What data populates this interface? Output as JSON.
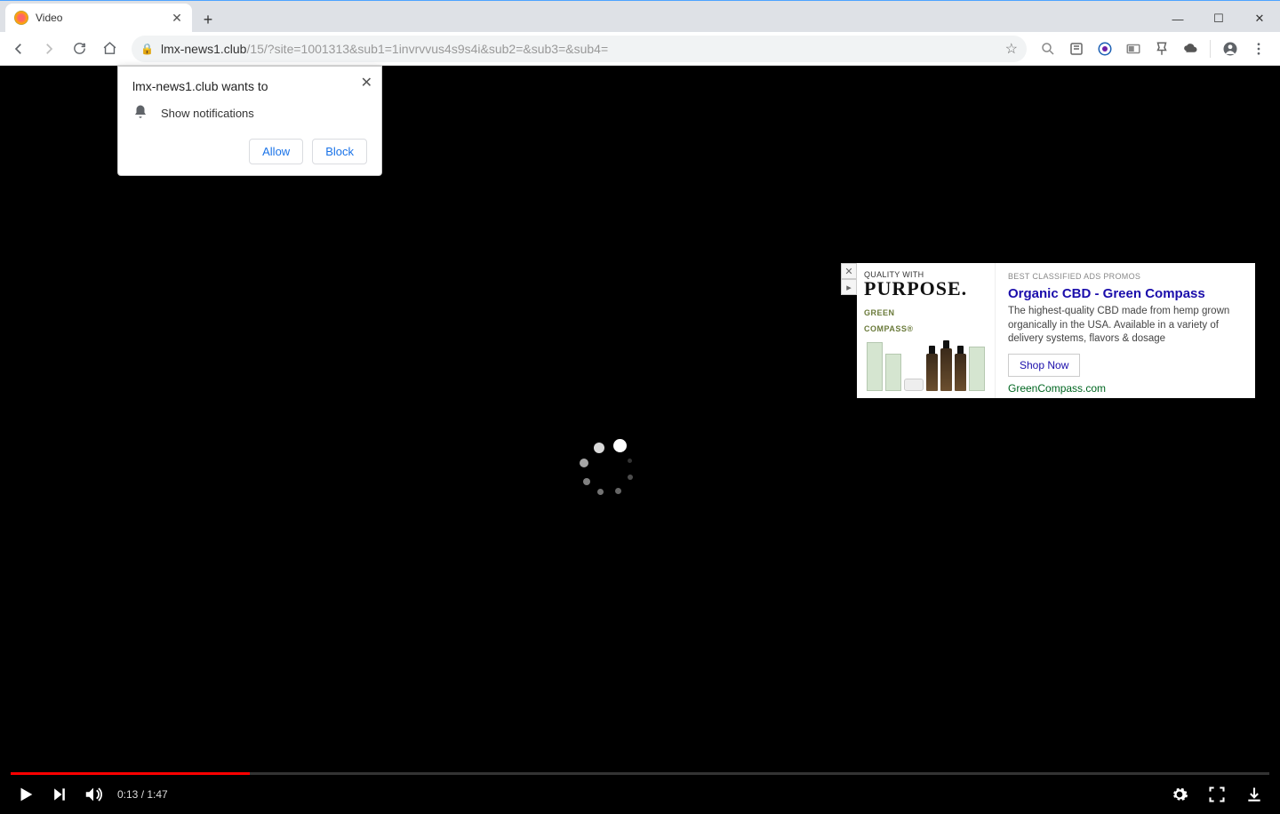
{
  "tab": {
    "title": "Video"
  },
  "url": {
    "domain": "lmx-news1.club",
    "path": "/15/?site=1001313&sub1=1invrvvus4s9s4i&sub2=&sub3=&sub4="
  },
  "permission": {
    "title": "lmx-news1.club wants to",
    "item": "Show notifications",
    "allow": "Allow",
    "block": "Block"
  },
  "video": {
    "current": "0:13",
    "duration": "1:47"
  },
  "ad": {
    "tagline1": "QUALITY WITH",
    "tagline2": "PURPOSE.",
    "brand1": "GREEN",
    "brand2": "COMPASS",
    "category": "BEST CLASSIFIED ADS PROMOS",
    "headline": "Organic CBD - Green Compass",
    "description": "The highest-quality CBD made from hemp grown organically in the USA. Available in a variety of delivery systems, flavors & dosage",
    "cta": "Shop Now",
    "url": "GreenCompass.com"
  }
}
